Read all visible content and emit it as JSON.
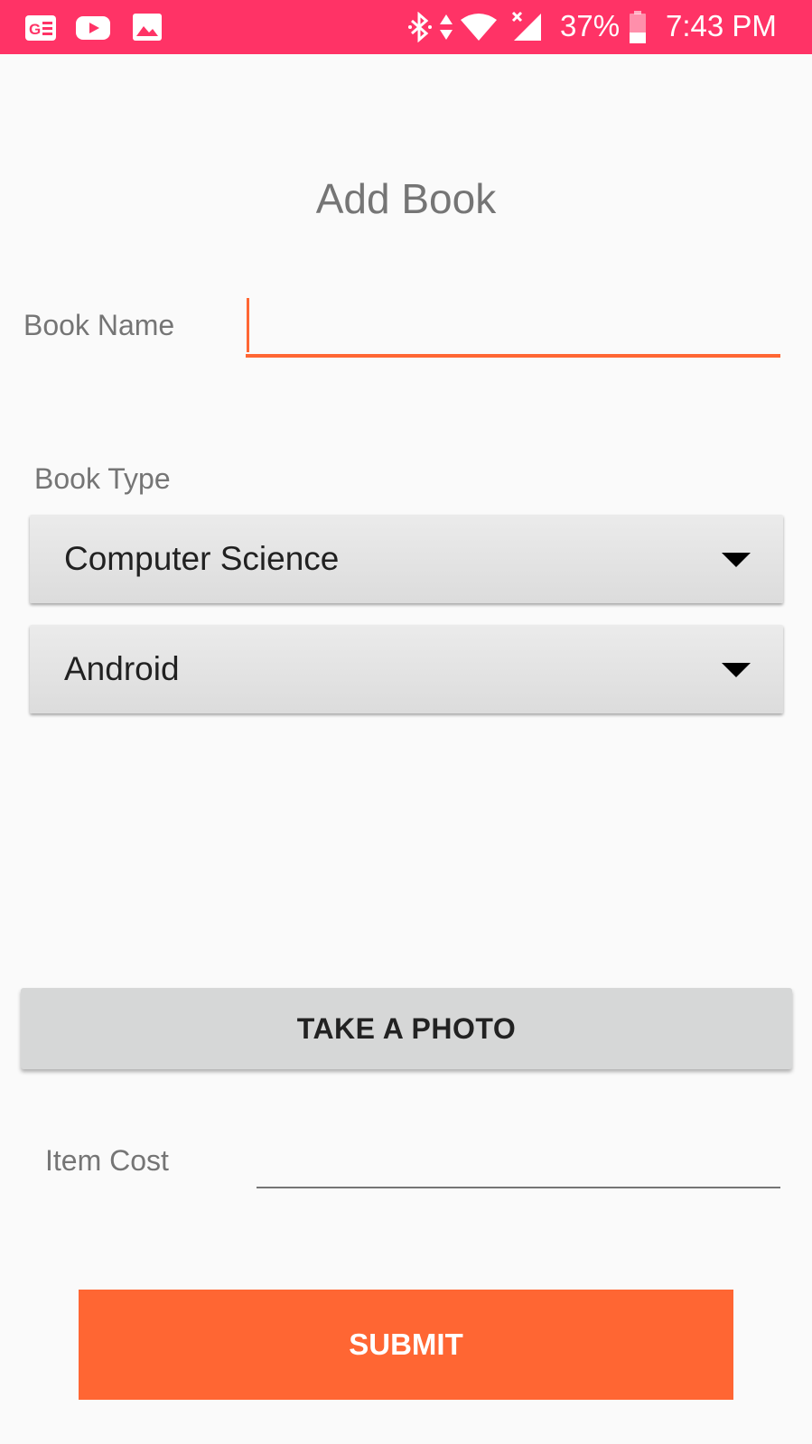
{
  "status_bar": {
    "battery": "37%",
    "time": "7:43 PM",
    "left_icons": [
      "google-news-icon",
      "youtube-icon",
      "gallery-icon"
    ],
    "right_icons": [
      "bluetooth-icon",
      "data-arrows-icon",
      "wifi-icon",
      "signal-icon",
      "battery-icon"
    ]
  },
  "form": {
    "title": "Add Book",
    "book_name_label": "Book Name",
    "book_name_value": "",
    "book_type_label": "Book Type",
    "category_selected": "Computer Science",
    "subcategory_selected": "Android",
    "take_photo_label": "TAKE A PHOTO",
    "item_cost_label": "Item Cost",
    "item_cost_value": "",
    "submit_label": "SUBMIT"
  },
  "colors": {
    "status_bar": "#ff3366",
    "accent": "#ff6633",
    "background": "#fafafa"
  }
}
